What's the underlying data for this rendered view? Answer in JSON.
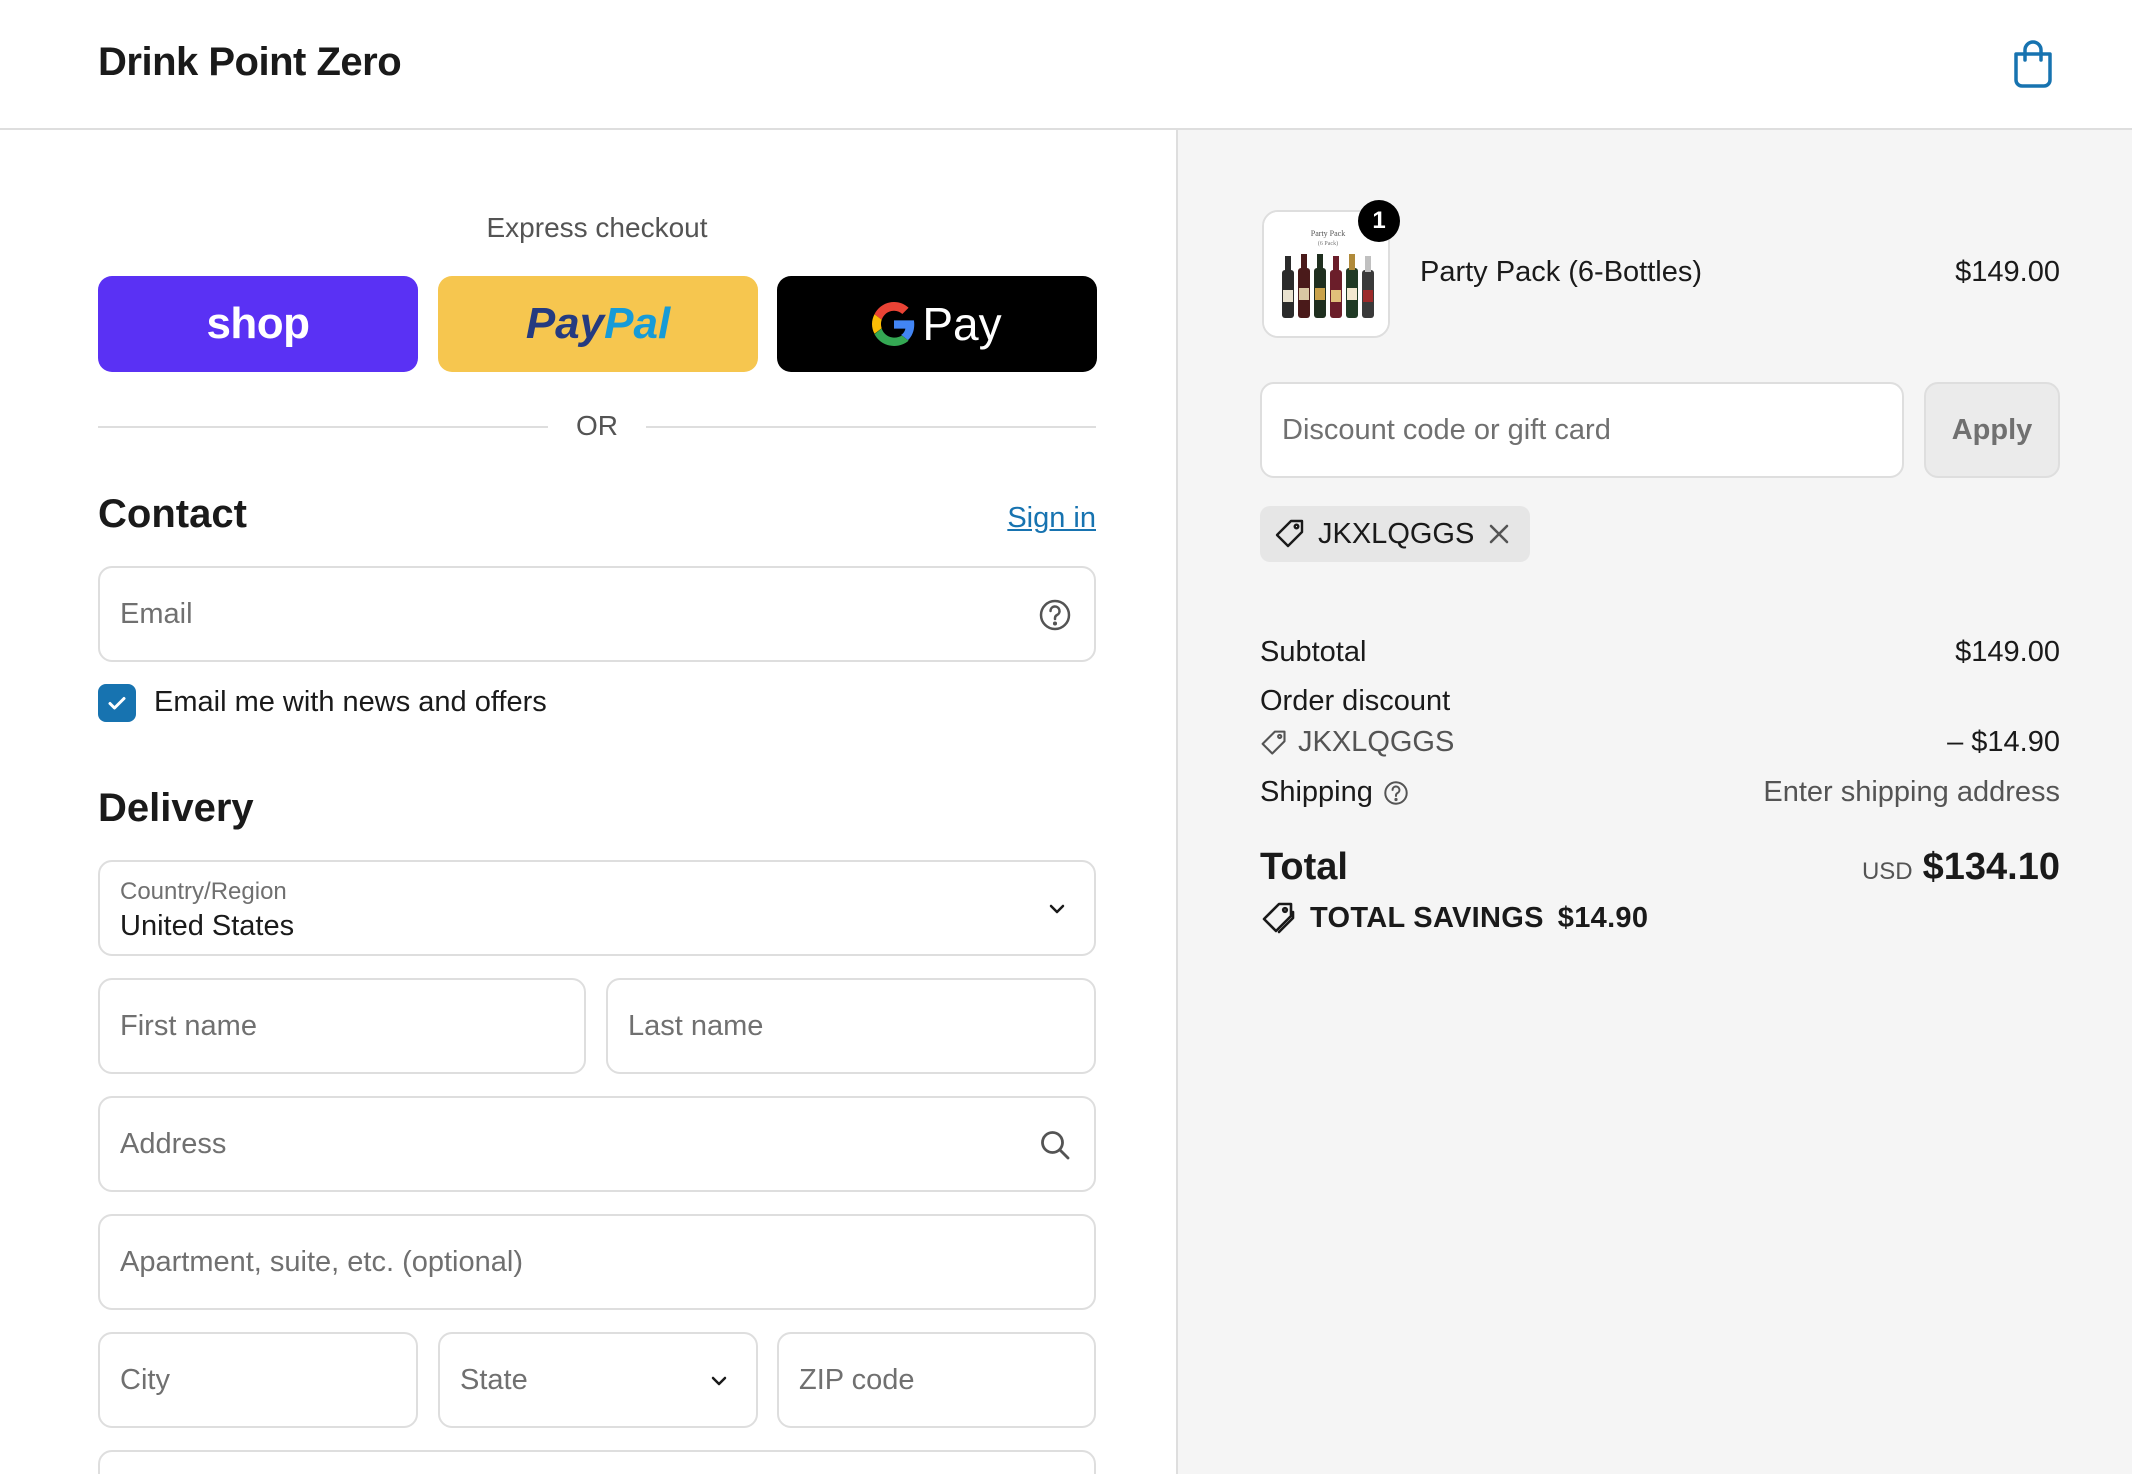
{
  "header": {
    "brand": "Drink Point Zero",
    "cart_icon": "shopping-bag-icon"
  },
  "express": {
    "label": "Express checkout",
    "shop_label": "shop",
    "paypal_part1": "Pay",
    "paypal_part2": "Pal",
    "gpay_label": "Pay",
    "or_label": "OR",
    "colors": {
      "shop": "#5a31f4",
      "paypal": "#f6c64f",
      "gpay": "#000000"
    }
  },
  "contact": {
    "title": "Contact",
    "sign_in": "Sign in",
    "email_placeholder": "Email",
    "newsletter_label": "Email me with news and offers",
    "newsletter_checked": true
  },
  "delivery": {
    "title": "Delivery",
    "country_label": "Country/Region",
    "country_value": "United States",
    "first_name_placeholder": "First name",
    "last_name_placeholder": "Last name",
    "address_placeholder": "Address",
    "apartment_placeholder": "Apartment, suite, etc. (optional)",
    "city_placeholder": "City",
    "state_placeholder": "State",
    "zip_placeholder": "ZIP code"
  },
  "order": {
    "product": {
      "name": "Party Pack (6-Bottles)",
      "price": "$149.00",
      "quantity": "1",
      "thumb_caption_1": "Party Pack",
      "thumb_caption_2": "(6 Pack)"
    },
    "discount_placeholder": "Discount code or gift card",
    "apply_label": "Apply",
    "applied_code": "JKXLQGGS",
    "summary": {
      "subtotal_label": "Subtotal",
      "subtotal_value": "$149.00",
      "order_discount_label": "Order discount",
      "discount_code": "JKXLQGGS",
      "discount_value": "– $14.90",
      "shipping_label": "Shipping",
      "shipping_value": "Enter shipping address",
      "total_label": "Total",
      "total_currency": "USD",
      "total_value": "$134.10",
      "savings_label": "TOTAL SAVINGS",
      "savings_value": "$14.90"
    }
  },
  "colors": {
    "accent": "#1773b0",
    "summary_bg": "#f5f5f5"
  }
}
